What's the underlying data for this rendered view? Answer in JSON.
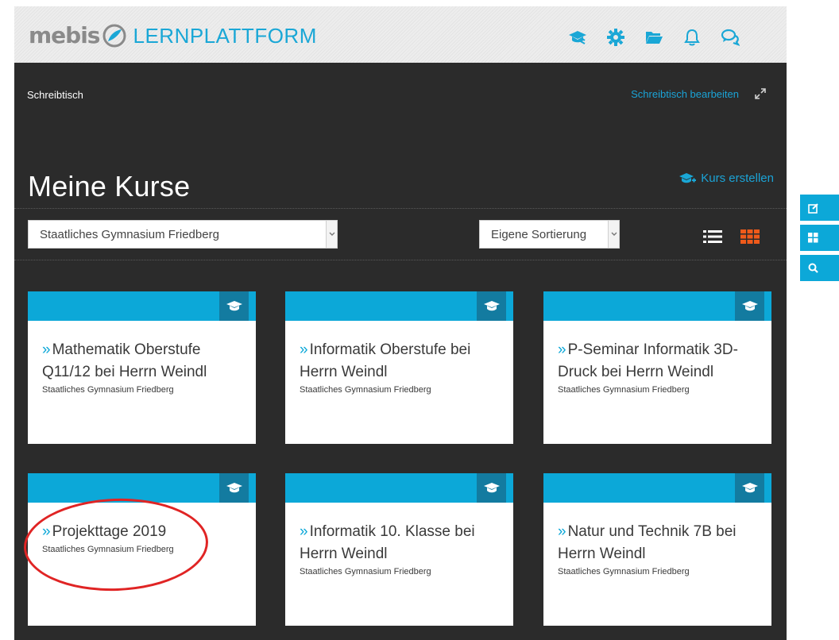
{
  "header": {
    "logo_word": "mebis",
    "logo_sub": "LERNPLATTFORM",
    "icons": [
      "graduation-cap-icon",
      "gear-icon",
      "folder-icon",
      "bell-icon",
      "chat-icon"
    ],
    "accent": "#1aa7d6"
  },
  "desk": {
    "breadcrumb": "Schreibtisch",
    "edit_link": "Schreibtisch bearbeiten"
  },
  "courses_section": {
    "title": "Meine Kurse",
    "create_label": "Kurs erstellen",
    "school_select": "Staatliches Gymnasium Friedberg",
    "sort_select": "Eigene Sortierung",
    "active_view": "grid"
  },
  "courses": [
    {
      "title": "Mathematik Oberstufe Q11/12 bei Herrn Weindl",
      "school": "Staatliches Gymnasium Friedberg"
    },
    {
      "title": "Informatik Oberstufe bei Herrn Weindl",
      "school": "Staatliches Gymnasium Friedberg"
    },
    {
      "title": "P-Seminar Informatik 3D-Druck bei Herrn Weindl",
      "school": "Staatliches Gymnasium Friedberg"
    },
    {
      "title": "Projekttage 2019",
      "school": "Staatliches Gymnasium Friedberg"
    },
    {
      "title": "Informatik 10. Klasse bei Herrn Weindl",
      "school": "Staatliches Gymnasium Friedberg"
    },
    {
      "title": "Natur und Technik 7B bei Herrn Weindl",
      "school": "Staatliches Gymnasium Friedberg"
    }
  ],
  "chevron": "»",
  "side_tabs": [
    "edit-icon",
    "blocks-icon",
    "search-icon"
  ],
  "highlight_color": "#e02424"
}
